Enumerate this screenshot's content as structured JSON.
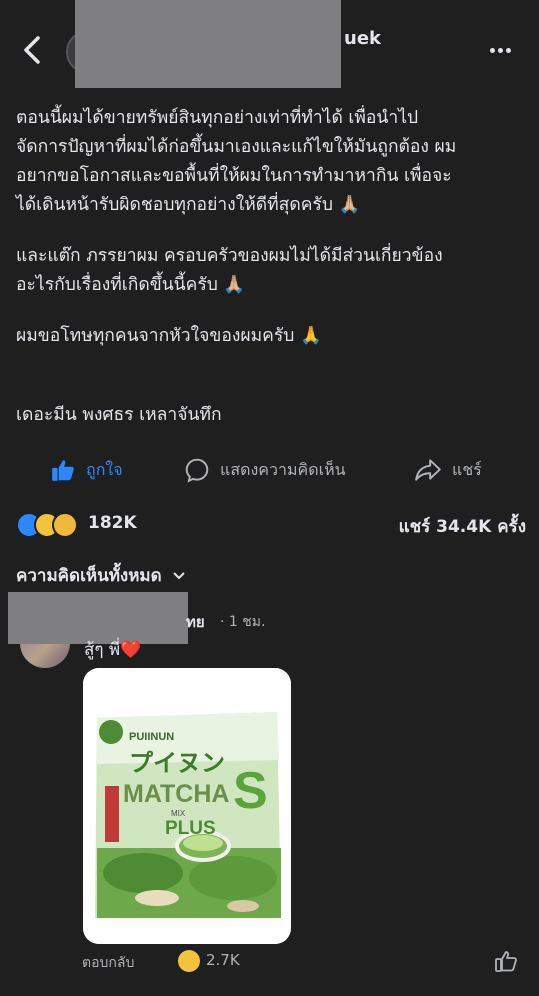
{
  "header": {
    "name_tail": "uek"
  },
  "post": {
    "paragraphs": [
      "ตอนนี้ผมได้ขายทรัพย์สินทุกอย่างเท่าที่ทำได้ เพื่อนำไป\nจัดการปัญหาที่ผมได้ก่อขึ้นมาเองและแก้ไขให้มันถูกต้อง ผม\nอยากขอโอกาสและขอพื้นที่ให้ผมในการทำมาหากิน เพื่อจะ\nได้เดินหน้ารับผิดชอบทุกอย่างให้ดีที่สุดครับ 🙏🏼",
      "และแต๊ก ภรรยาผม ครอบครัวของผมไม่ได้มีส่วนเกี่ยวข้อง\nอะไรกับเรื่องที่เกิดขึ้นนี้ครับ 🙏🏼",
      "ผมขอโทษทุกคนจากหัวใจของผมครับ 🙏",
      "เดอะมีน พงศธร เหลาจันทึก"
    ]
  },
  "actions": {
    "like": "ถูกใจ",
    "comment": "แสดงความคิดเห็น",
    "share": "แชร์"
  },
  "stats": {
    "reaction_count": "182K",
    "share_count": "แชร์ 34.4K ครั้ง"
  },
  "comments": {
    "filter_label": "ความคิดเห็นทั้งหมด",
    "first": {
      "author_tail": "ทย",
      "time": "· 1 ชม.",
      "text": "สู้ๆ พี่❤️",
      "reply_label": "ตอบกลับ",
      "reaction_count": "2.7K",
      "image": {
        "brand": "PUIINUN",
        "japanese": "プイヌン",
        "product": "MATCHA",
        "letter": "S",
        "mix": "MIX",
        "plus": "PLUS"
      }
    }
  },
  "colors": {
    "background": "#1f1f1f",
    "text": "#e4e6eb",
    "muted": "#b0b3b8",
    "like_blue": "#2d88ff",
    "redaction": "#7f7f82"
  }
}
